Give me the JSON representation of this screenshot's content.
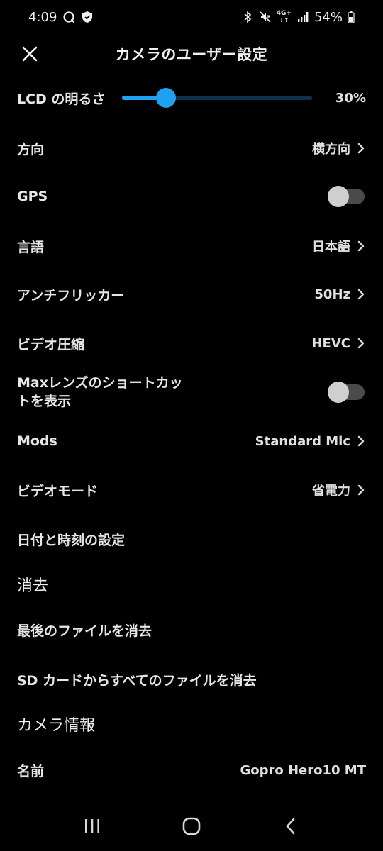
{
  "status_bar": {
    "time": "4:09",
    "battery_percent": "54%",
    "network_badge": "4G+",
    "icons": [
      "messenger-icon",
      "shield-icon",
      "bluetooth-icon",
      "mute-icon",
      "network-icon",
      "signal-icon",
      "battery-icon"
    ]
  },
  "header": {
    "title": "カメラのユーザー設定",
    "close_icon": "close-icon"
  },
  "lcd": {
    "label": "LCD の明るさ",
    "value": "30%",
    "level": 0.23
  },
  "rows": {
    "orientation": {
      "label": "方向",
      "value": "横方向"
    },
    "gps": {
      "label": "GPS",
      "enabled": false
    },
    "language": {
      "label": "言語",
      "value": "日本語"
    },
    "anti_flicker": {
      "label": "アンチフリッカー",
      "value": "50Hz"
    },
    "video_compression": {
      "label": "ビデオ圧縮",
      "value": "HEVC"
    },
    "max_lens": {
      "label_line1": "Maxレンズのショートカッ",
      "label_line2": "トを表示",
      "enabled": false
    },
    "mods": {
      "label": "Mods",
      "value": "Standard Mic"
    },
    "video_mode": {
      "label": "ビデオモード",
      "value": "省電力"
    },
    "date_time": {
      "label": "日付と時刻の設定"
    }
  },
  "sections": {
    "delete": {
      "title": "消去",
      "delete_last": "最後のファイルを消去",
      "delete_all": "SD カードからすべてのファイルを消去"
    },
    "camera_info": {
      "title": "カメラ情報",
      "name_label": "名前",
      "name_value": "Gopro Hero10 MT"
    }
  },
  "colors": {
    "accent": "#1ea1f1",
    "track": "#10314a",
    "background": "#000000"
  }
}
